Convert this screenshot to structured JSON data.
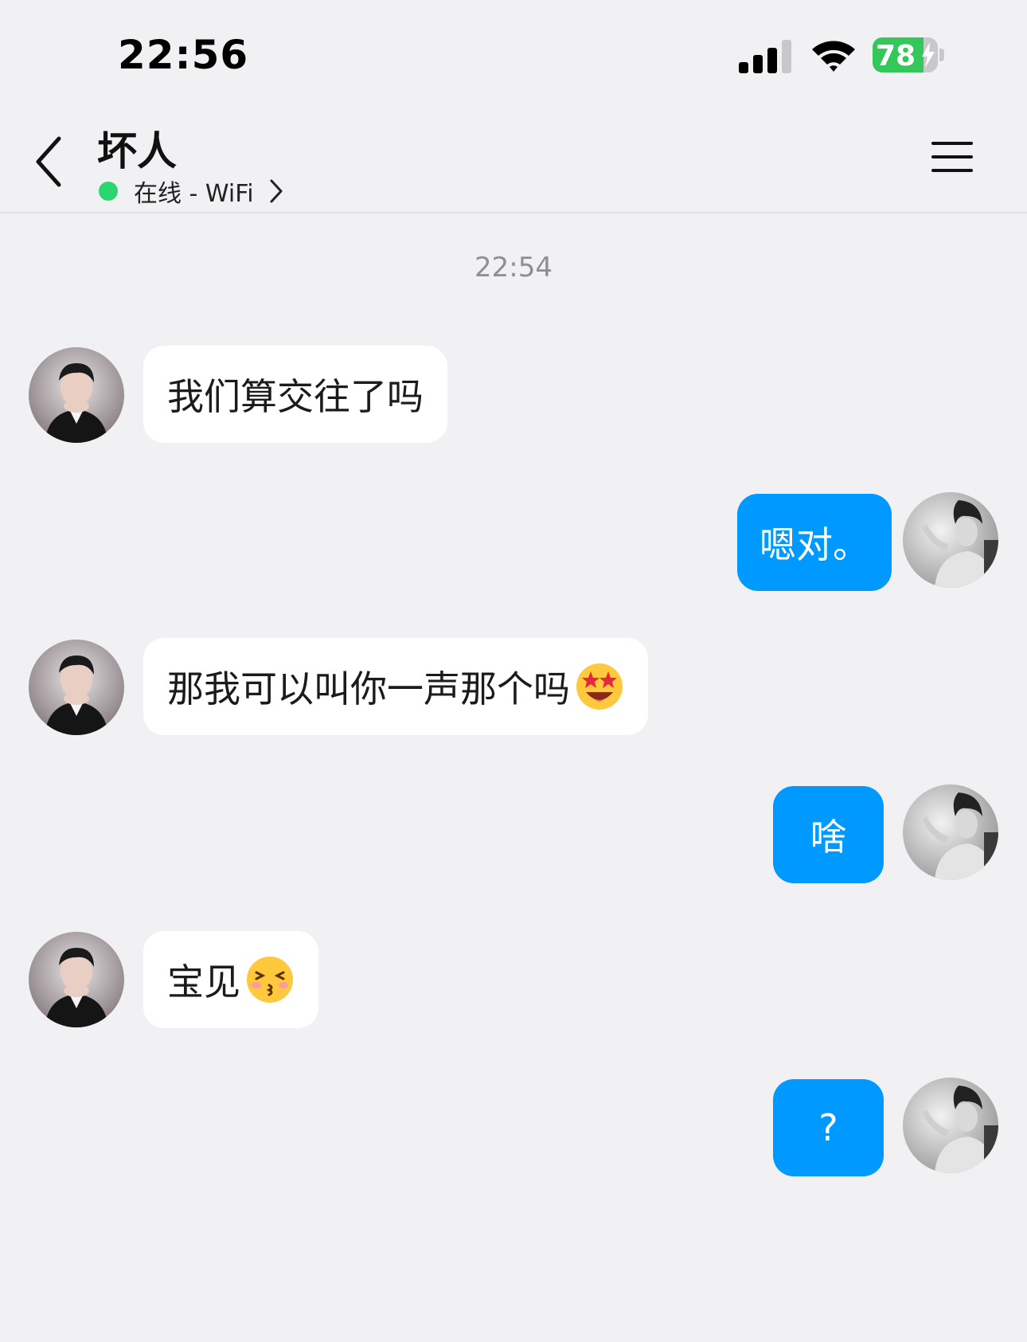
{
  "status_bar": {
    "time": "22:56",
    "battery_level": "78",
    "battery_percent": 78,
    "signal_bars": 3,
    "charging": true
  },
  "header": {
    "contact_name": "坏人",
    "presence": "在线 - WiFi",
    "presence_color": "#2bd56f"
  },
  "chat": {
    "timestamp": "22:54",
    "messages": [
      {
        "from": "contact",
        "text": "我们算交往了吗"
      },
      {
        "from": "me",
        "text": "嗯对。"
      },
      {
        "from": "contact",
        "text": "那我可以叫你一声那个吗",
        "emoji": "star-struck-emoji"
      },
      {
        "from": "me",
        "text": "啥"
      },
      {
        "from": "contact",
        "text": "宝见",
        "emoji": "kissing-emoji"
      },
      {
        "from": "me",
        "text": "?"
      }
    ]
  },
  "colors": {
    "background": "#f1f1f3",
    "incoming_bubble": "#ffffff",
    "outgoing_bubble": "#0099ff",
    "battery_green": "#34c759"
  }
}
